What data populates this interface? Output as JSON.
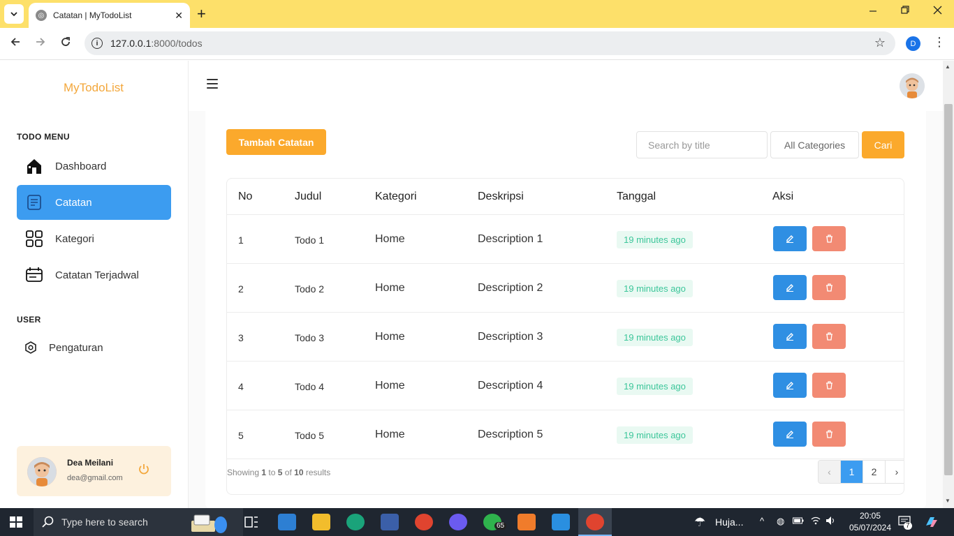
{
  "browser": {
    "tab_title": "Catatan | MyTodoList",
    "url_host": "127.0.0.1",
    "url_rest": ":8000/todos",
    "profile_letter": "D"
  },
  "sidebar": {
    "brand": "MyTodoList",
    "todo_menu_title": "TODO MENU",
    "items": [
      {
        "label": "Dashboard",
        "icon": "home-icon"
      },
      {
        "label": "Catatan",
        "icon": "note-icon",
        "active": true
      },
      {
        "label": "Kategori",
        "icon": "grid-icon"
      },
      {
        "label": "Catatan Terjadwal",
        "icon": "calendar-icon"
      }
    ],
    "user_title": "USER",
    "settings_label": "Pengaturan",
    "user": {
      "name": "Dea Meilani",
      "email": "dea@gmail.com"
    }
  },
  "toolbar": {
    "add_label": "Tambah Catatan",
    "search_placeholder": "Search by title",
    "category_selected": "All Categories",
    "search_button": "Cari"
  },
  "table": {
    "headers": [
      "No",
      "Judul",
      "Kategori",
      "Deskripsi",
      "Tanggal",
      "Aksi"
    ],
    "rows": [
      {
        "no": "1",
        "title": "Todo 1",
        "category": "Home",
        "description": "Description 1",
        "date": "19 minutes ago"
      },
      {
        "no": "2",
        "title": "Todo 2",
        "category": "Home",
        "description": "Description 2",
        "date": "19 minutes ago"
      },
      {
        "no": "3",
        "title": "Todo 3",
        "category": "Home",
        "description": "Description 3",
        "date": "19 minutes ago"
      },
      {
        "no": "4",
        "title": "Todo 4",
        "category": "Home",
        "description": "Description 4",
        "date": "19 minutes ago"
      },
      {
        "no": "5",
        "title": "Todo 5",
        "category": "Home",
        "description": "Description 5",
        "date": "19 minutes ago"
      }
    ]
  },
  "pagination": {
    "showing_prefix": "Showing",
    "from": "1",
    "to_word": "to",
    "to": "5",
    "of_word": "of",
    "total": "10",
    "suffix": "results",
    "prev": "‹",
    "pages": [
      "1",
      "2"
    ],
    "current": "1",
    "next": "›"
  },
  "taskbar": {
    "search_placeholder": "Type here to search",
    "weather": "Huja...",
    "time": "20:05",
    "date": "05/07/2024",
    "whatsapp_badge": "65",
    "notification_count": "7"
  },
  "colors": {
    "accent_orange": "#fba92c",
    "active_blue": "#3c9cf0",
    "edit_blue": "#2f8fe3",
    "delete_red": "#f28a73",
    "badge_green": "#3cc69a",
    "browser_frame": "#fde06a"
  }
}
